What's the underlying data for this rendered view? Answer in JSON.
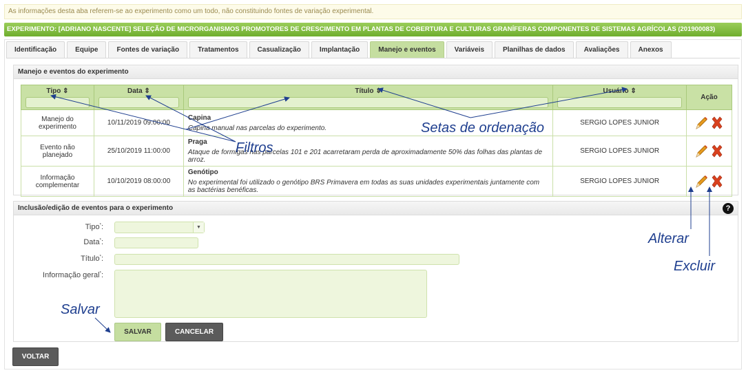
{
  "notice": "As informações desta aba referem-se ao experimento como um todo, não constituindo fontes de variação experimental.",
  "experiment_title": "EXPERIMENTO: [ADRIANO NASCENTE] SELEÇÃO DE MICRORGANISMOS PROMOTORES DE CRESCIMENTO EM PLANTAS DE COBERTURA E CULTURAS GRANÍFERAS COMPONENTES DE SISTEMAS AGRÍCOLAS (201900083)",
  "tabs": [
    "Identificação",
    "Equipe",
    "Fontes de variação",
    "Tratamentos",
    "Casualização",
    "Implantação",
    "Manejo e eventos",
    "Variáveis",
    "Planilhas de dados",
    "Avaliações",
    "Anexos"
  ],
  "active_tab": "Manejo e eventos",
  "events_section": {
    "title": "Manejo e eventos do experimento",
    "columns": {
      "tipo": "Tipo ⇕",
      "data": "Data ⇕",
      "titulo": "Título ⇕",
      "usuario": "Usuário ⇕",
      "acao": "Ação"
    },
    "rows": [
      {
        "tipo": "Manejo do experimento",
        "data": "10/11/2019 09:00:00",
        "titulo": "Capina",
        "descricao": "Capina manual nas parcelas do experimento.",
        "usuario": "SERGIO LOPES JUNIOR"
      },
      {
        "tipo": "Evento não planejado",
        "data": "25/10/2019 11:00:00",
        "titulo": "Praga",
        "descricao": "Ataque de formigas nas parcelas 101 e 201 acarretaram perda de aproximadamente 50% das folhas das plantas de arroz.",
        "usuario": "SERGIO LOPES JUNIOR"
      },
      {
        "tipo": "Informação complementar",
        "data": "10/10/2019 08:00:00",
        "titulo": "Genótipo",
        "descricao": "No experimental foi utilizado o genótipo BRS Primavera em todas as suas unidades experimentais juntamente com as bactérias benéficas.",
        "usuario": "SERGIO LOPES JUNIOR"
      }
    ]
  },
  "form_section": {
    "title": "Inclusão/edição de eventos para o experimento",
    "help": "?",
    "labels": {
      "tipo": "Tipo",
      "data": "Data",
      "titulo": "Título",
      "info": "Informação geral"
    },
    "required_mark": "*",
    "label_suffix": ":",
    "buttons": {
      "save": "SALVAR",
      "cancel": "CANCELAR"
    }
  },
  "back_button": "VOLTAR",
  "annotations": {
    "sort_arrows": "Setas de ordenação",
    "filters": "Filtros",
    "edit": "Alterar",
    "delete": "Excluir",
    "save": "Salvar"
  },
  "colors": {
    "accent_green": "#6fae2d",
    "header_green": "#c9e1a5",
    "annotation_blue": "#1f3f8f",
    "delete_red": "#d9411e",
    "edit_orange": "#e69a1e"
  }
}
